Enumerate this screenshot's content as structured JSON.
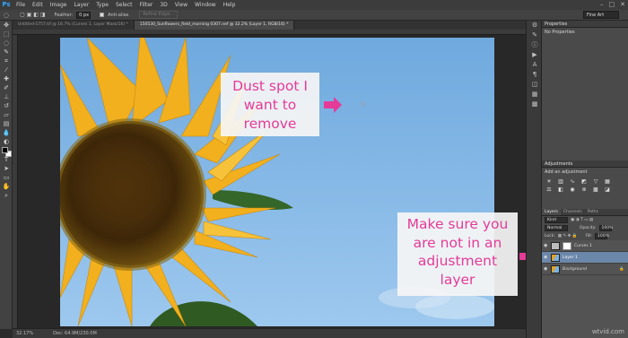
{
  "menubar": {
    "logo": "Ps",
    "items": [
      "File",
      "Edit",
      "Image",
      "Layer",
      "Type",
      "Select",
      "Filter",
      "3D",
      "View",
      "Window",
      "Help"
    ],
    "window_controls": [
      "–",
      "□",
      "✕"
    ]
  },
  "options": {
    "feather_label": "Feather:",
    "feather_value": "0 px",
    "antialias_label": "Anti-alias",
    "refine_edge_label": "Refine Edge...",
    "workspace": "Fine Art"
  },
  "tabs": [
    {
      "label": "Untitled-5757.tif @ 16.7% (Curves 1, Layer Mask/16) *"
    },
    {
      "label": "150530_Sunflowers_field_morning 0307.nef @ 32.2% (Layer 1, RGB/16) *"
    }
  ],
  "annotations": {
    "dust_lines": [
      "Dust spot I",
      "want to",
      "remove"
    ],
    "layer_lines": [
      "Make sure you",
      "are not in an",
      "adjustment",
      "layer"
    ]
  },
  "status": {
    "zoom": "32.17%",
    "doc": "Doc: 64.9M/230.0M"
  },
  "panels": {
    "properties_title": "Properties",
    "properties_text": "No Properties",
    "adjustments_title": "Adjustments",
    "adjustments_hint": "Add an adjustment",
    "layers_tabs": [
      "Layers",
      "Channels",
      "Paths"
    ],
    "kind_label": "Kind",
    "blend_mode": "Normal",
    "opacity_label": "Opacity:",
    "opacity_value": "100%",
    "lock_label": "Lock:",
    "fill_label": "Fill:",
    "fill_value": "100%",
    "layers": [
      {
        "name": "Curves 1"
      },
      {
        "name": "Layer 1"
      },
      {
        "name": "Background"
      }
    ]
  },
  "watermark": "wtvid.com",
  "colors": {
    "annotation_pink": "#e43b98",
    "selected_layer": "#6b87a9",
    "sky_blue": "#7fb6e6"
  }
}
